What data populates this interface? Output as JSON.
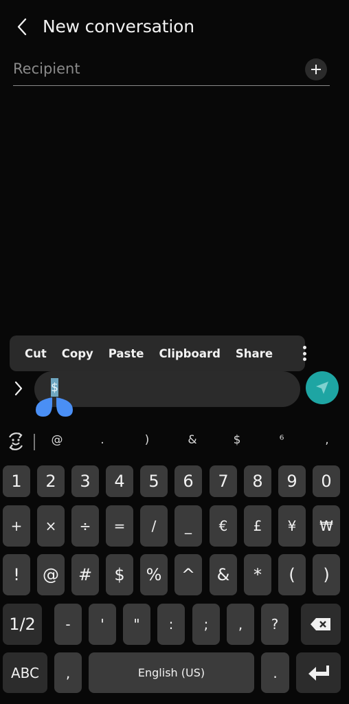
{
  "header": {
    "title": "New conversation",
    "back_icon": "chevron-left-icon"
  },
  "recipient": {
    "placeholder": "Recipient",
    "value": "",
    "add_icon": "plus-icon"
  },
  "context_menu": {
    "items": [
      "Cut",
      "Copy",
      "Paste",
      "Clipboard",
      "Share"
    ],
    "more_icon": "more-vertical-icon"
  },
  "composer": {
    "expand_icon": "chevron-right-icon",
    "selected_text": "$",
    "send_icon": "send-icon",
    "send_color": "#1ea5a3",
    "selection_color": "#6fa7c1",
    "handle_color": "#4a8ff5"
  },
  "suggestion_bar": {
    "emoji_icon": "emoji-toggle-icon",
    "items": [
      "@",
      ".",
      ")",
      "&",
      "$",
      "⁶",
      ","
    ]
  },
  "keyboard": {
    "row1": [
      "1",
      "2",
      "3",
      "4",
      "5",
      "6",
      "7",
      "8",
      "9",
      "0"
    ],
    "row2": [
      "+",
      "×",
      "÷",
      "=",
      "/",
      "_",
      "€",
      "£",
      "¥",
      "₩"
    ],
    "row3": [
      "!",
      "@",
      "#",
      "$",
      "%",
      "^",
      "&",
      "*",
      "(",
      ")"
    ],
    "row4": {
      "page_toggle": "1/2",
      "keys": [
        "-",
        "'",
        "\"",
        ":",
        ";",
        ",",
        "?"
      ],
      "backspace_icon": "backspace-icon"
    },
    "row5": {
      "abc": "ABC",
      "comma": ",",
      "space": "English (US)",
      "period": ".",
      "enter_icon": "enter-icon"
    }
  }
}
